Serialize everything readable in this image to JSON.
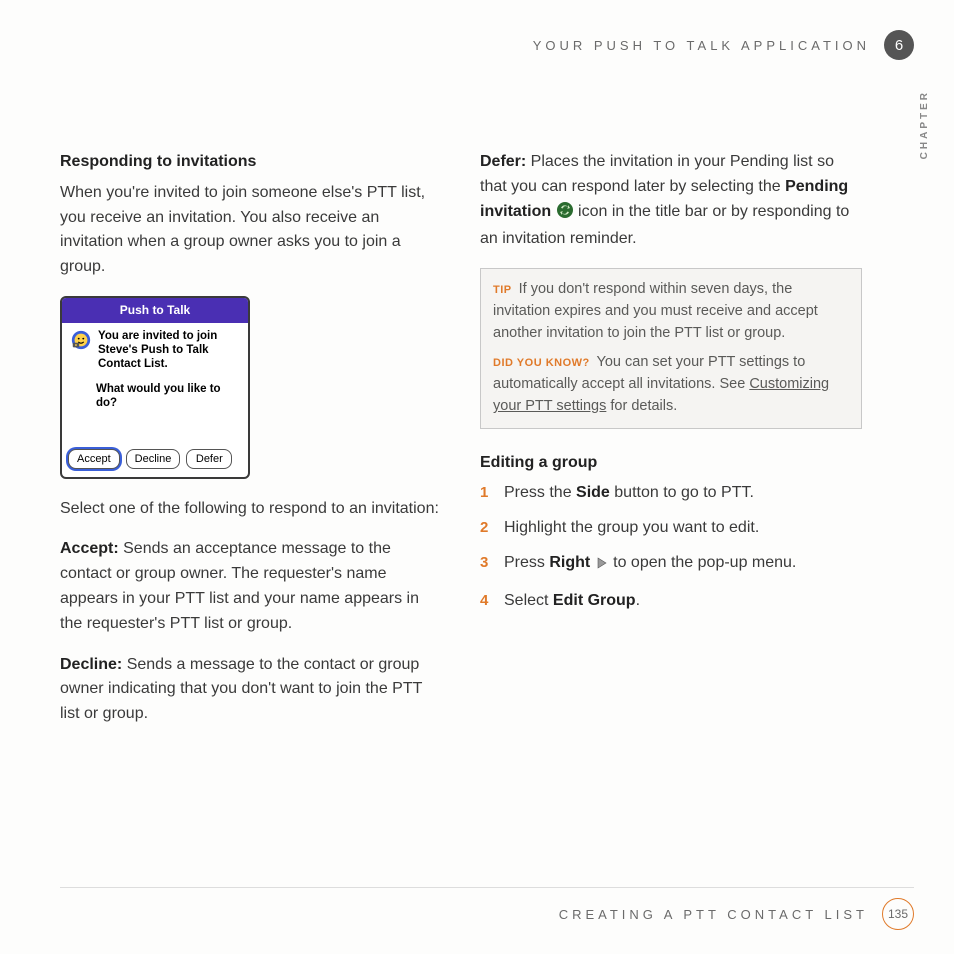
{
  "header": {
    "title": "YOUR PUSH TO TALK APPLICATION",
    "chapter_num": "6",
    "chapter_label": "CHAPTER"
  },
  "left": {
    "h1": "Responding to invitations",
    "p1": "When you're invited to join someone else's PTT list, you receive an invitation. You also receive an invitation when a group owner asks you to join a group.",
    "pda": {
      "title": "Push to Talk",
      "line1": "You are invited to join Steve's Push to Talk Contact List.",
      "line2": "What would you like to do?",
      "btn_accept": "Accept",
      "btn_decline": "Decline",
      "btn_defer": "Defer"
    },
    "p2": "Select one of the following to respond to an invitation:",
    "accept_label": "Accept:",
    "accept_text": " Sends an acceptance message to the contact or group owner. The requester's name appears in your PTT list and your name appears in the requester's PTT list or group.",
    "decline_label": "Decline:",
    "decline_text": " Sends a message to the contact or group owner indicating that you don't want to join the PTT list or group."
  },
  "right": {
    "defer_label": "Defer:",
    "defer_text_a": " Places the invitation in your Pending list so that you can respond later by selecting the ",
    "defer_bold": "Pending invitation",
    "defer_text_b": " icon in the title bar or by responding to an invitation reminder.",
    "tip_tag": "TIP",
    "tip_text": " If you don't respond within seven days, the invitation expires and you must receive and accept another invitation to join the PTT list or group.",
    "dyk_tag": "DID YOU KNOW?",
    "dyk_text_a": "  You can set your PTT settings to automatically accept all invitations. See ",
    "dyk_link": "Customizing your PTT settings",
    "dyk_text_b": " for details.",
    "h2": "Editing a group",
    "steps": [
      {
        "n": "1",
        "pre": "Press the ",
        "bold": "Side",
        "post": " button to go to PTT."
      },
      {
        "n": "2",
        "pre": "Highlight the group you want to edit.",
        "bold": "",
        "post": ""
      },
      {
        "n": "3",
        "pre": "Press ",
        "bold": "Right",
        "post": " to open the pop-up menu.",
        "icon": "right"
      },
      {
        "n": "4",
        "pre": "Select ",
        "bold": "Edit Group",
        "post": "."
      }
    ]
  },
  "footer": {
    "title": "CREATING A PTT CONTACT LIST",
    "page": "135"
  }
}
